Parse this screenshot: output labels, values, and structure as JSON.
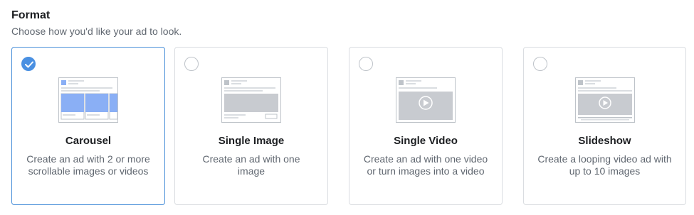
{
  "header": {
    "title": "Format",
    "subtitle": "Choose how you'd like your ad to look."
  },
  "formats": [
    {
      "id": "carousel",
      "title": "Carousel",
      "description": "Create an ad with 2 or more scrollable images or videos",
      "selected": true,
      "icon": "carousel-preview-icon"
    },
    {
      "id": "single-image",
      "title": "Single Image",
      "description": "Create an ad with one image",
      "selected": false,
      "icon": "single-image-preview-icon"
    },
    {
      "id": "single-video",
      "title": "Single Video",
      "description": "Create an ad with one video or turn images into a video",
      "selected": false,
      "icon": "single-video-preview-icon"
    },
    {
      "id": "slideshow",
      "title": "Slideshow",
      "description": "Create a looping video ad with up to 10 images",
      "selected": false,
      "icon": "slideshow-preview-icon"
    }
  ],
  "colors": {
    "accent": "#4a90e2",
    "carousel_fill": "#8aaff5",
    "placeholder_fill": "#bec3c9",
    "border": "#dadde1",
    "selected_border": "#4a90d9"
  }
}
